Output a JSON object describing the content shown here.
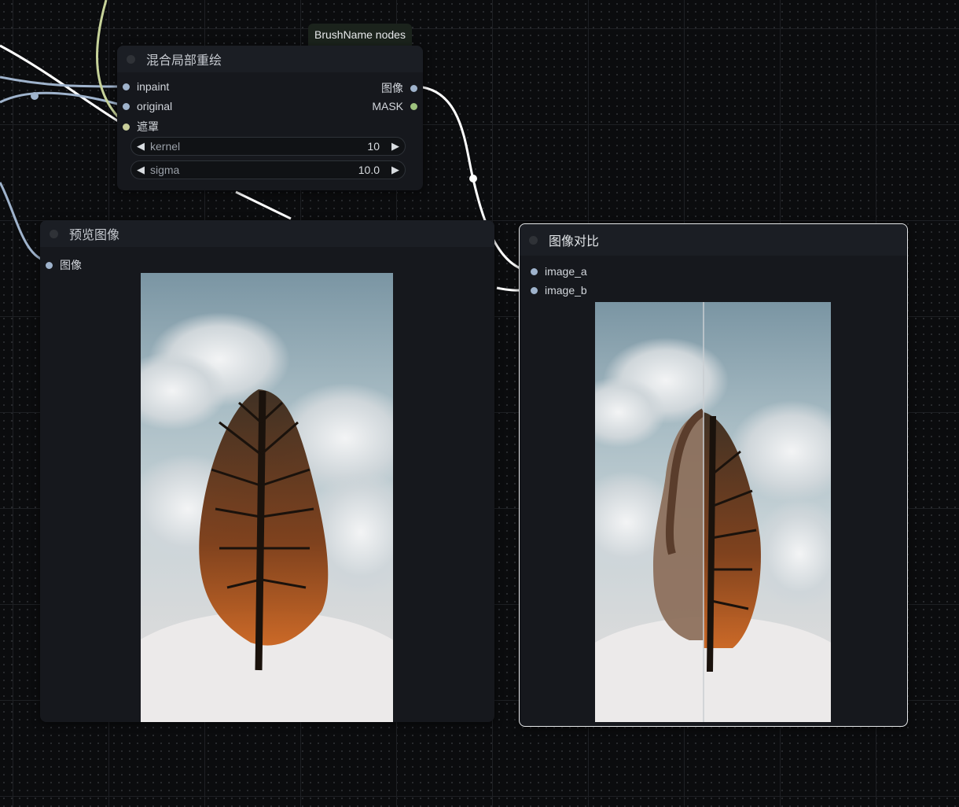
{
  "badge": {
    "label": "BrushName nodes"
  },
  "blend_node": {
    "title": "混合局部重绘",
    "inputs": [
      {
        "label": "inpaint",
        "type": "image"
      },
      {
        "label": "original",
        "type": "image"
      },
      {
        "label": "遮罩",
        "type": "mask"
      }
    ],
    "outputs": [
      {
        "label": "图像",
        "type": "image"
      },
      {
        "label": "MASK",
        "type": "mask"
      }
    ],
    "widgets": [
      {
        "label": "kernel",
        "value": "10"
      },
      {
        "label": "sigma",
        "value": "10.0"
      }
    ]
  },
  "preview_node": {
    "title": "预览图像",
    "input_label": "图像",
    "image_description": "clouds-with-tree-silhouette"
  },
  "compare_node": {
    "title": "图像对比",
    "inputs": [
      {
        "label": "image_a"
      },
      {
        "label": "image_b"
      }
    ],
    "image_description": "split-comparison-woman-and-tree"
  },
  "colors": {
    "image_socket": "#9fb3cc",
    "mask_socket": "#9ec27e",
    "link_image": "#9fb3cc",
    "link_white": "#ffffff",
    "link_latent": "#c7d39a",
    "node_bg": "#16181d",
    "canvas_bg": "#0b0c0e"
  }
}
